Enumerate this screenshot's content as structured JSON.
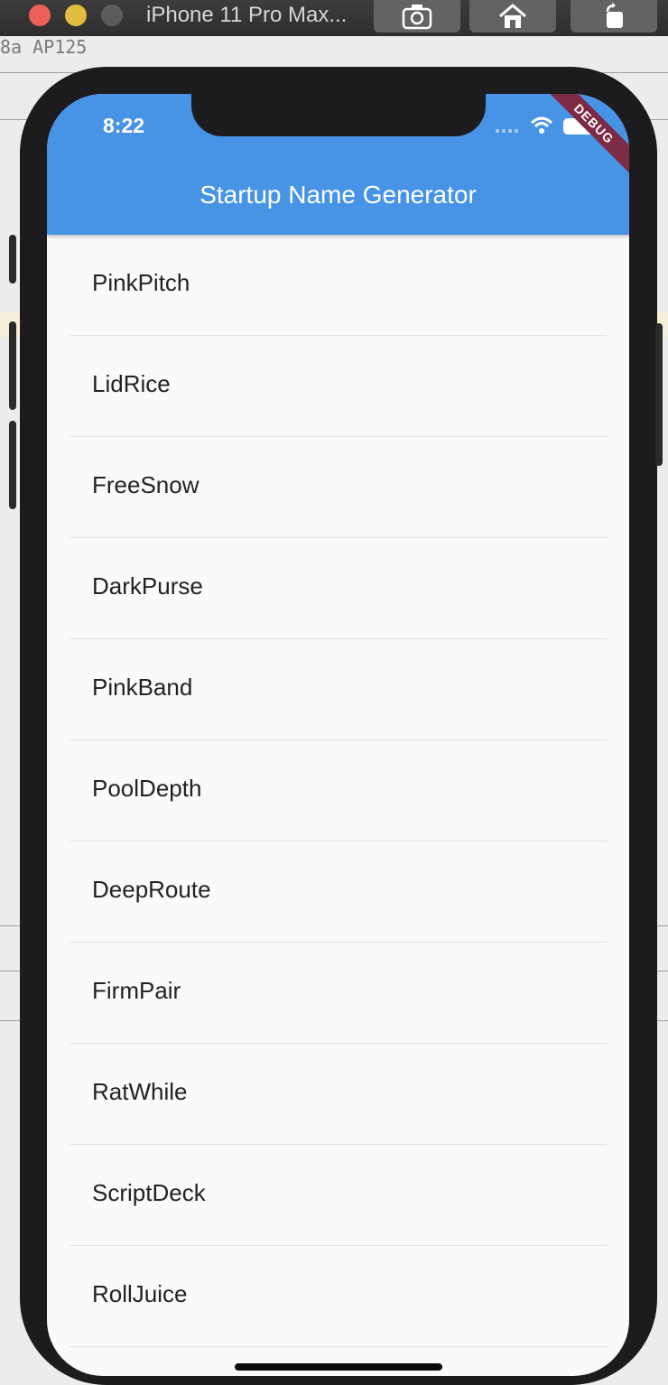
{
  "simulator": {
    "title": "iPhone 11 Pro Max...",
    "buttons": [
      "screenshot-icon",
      "home-icon",
      "rotate-icon"
    ]
  },
  "ide": {
    "fragment": "8a AP125"
  },
  "status_bar": {
    "time": "8:22"
  },
  "appbar": {
    "title": "Startup Name Generator",
    "color": "#4793e6"
  },
  "debug_banner": "DEBUG",
  "list": {
    "items": [
      "PinkPitch",
      "LidRice",
      "FreeSnow",
      "DarkPurse",
      "PinkBand",
      "PoolDepth",
      "DeepRoute",
      "FirmPair",
      "RatWhile",
      "ScriptDeck",
      "RollJuice"
    ]
  }
}
